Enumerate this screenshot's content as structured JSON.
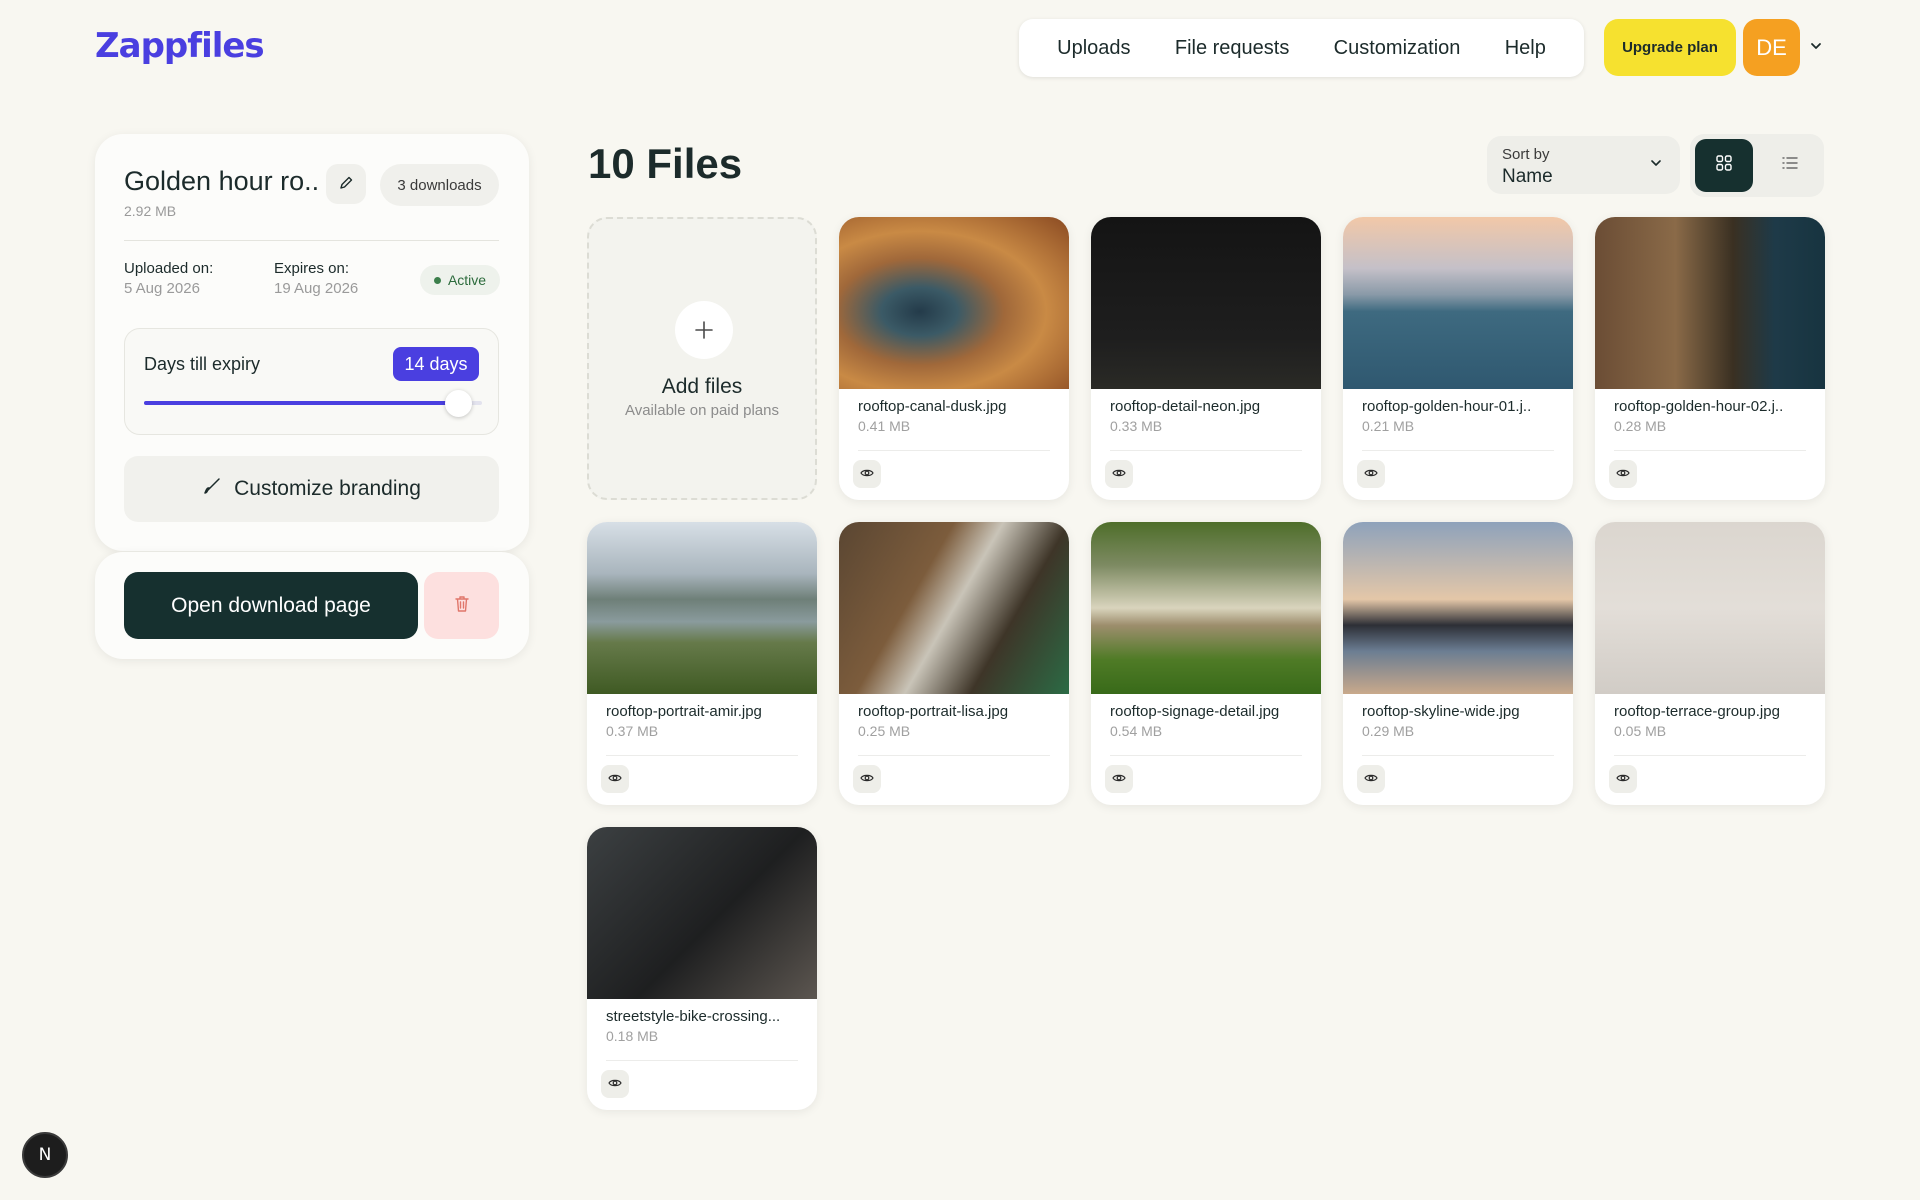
{
  "brand": {
    "logo": "Zappfiles"
  },
  "nav": {
    "items": [
      "Uploads",
      "File requests",
      "Customization",
      "Help"
    ]
  },
  "header": {
    "upgrade_label": "Upgrade plan",
    "avatar_initials": "DE"
  },
  "transfer": {
    "title": "Golden hour ro..",
    "size": "2.92 MB",
    "downloads": "3 downloads",
    "uploaded_label": "Uploaded on:",
    "uploaded_value": "5 Aug 2026",
    "expires_label": "Expires on:",
    "expires_value": "19 Aug 2026",
    "status": "Active",
    "expiry_label": "Days till expiry",
    "expiry_badge": "14 days",
    "expiry_fraction": 0.93,
    "branding_label": "Customize branding",
    "open_label": "Open download page"
  },
  "main": {
    "title": "10 Files",
    "sort_label": "Sort by",
    "sort_value": "Name",
    "add_title": "Add files",
    "add_sub": "Available on paid plans",
    "files": [
      {
        "name": "rooftop-canal-dusk.jpg",
        "size": "0.41 MB",
        "thumb": "canyon"
      },
      {
        "name": "rooftop-detail-neon.jpg",
        "size": "0.33 MB",
        "thumb": "van"
      },
      {
        "name": "rooftop-golden-hour-01.j..",
        "size": "0.21 MB",
        "thumb": "sea"
      },
      {
        "name": "rooftop-golden-hour-02.j..",
        "size": "0.28 MB",
        "thumb": "cliff"
      },
      {
        "name": "rooftop-portrait-amir.jpg",
        "size": "0.37 MB",
        "thumb": "lake"
      },
      {
        "name": "rooftop-portrait-lisa.jpg",
        "size": "0.25 MB",
        "thumb": "desk"
      },
      {
        "name": "rooftop-signage-detail.jpg",
        "size": "0.54 MB",
        "thumb": "dock"
      },
      {
        "name": "rooftop-skyline-wide.jpg",
        "size": "0.29 MB",
        "thumb": "sky"
      },
      {
        "name": "rooftop-terrace-group.jpg",
        "size": "0.05 MB",
        "thumb": "fog"
      },
      {
        "name": "streetstyle-bike-crossing...",
        "size": "0.18 MB",
        "thumb": "dog"
      }
    ]
  },
  "footer": {
    "badge": "N"
  },
  "colors": {
    "accent": "#4a3fe0",
    "dark": "#16302f",
    "upgrade": "#f6e12f",
    "avatar": "#f5a021"
  }
}
